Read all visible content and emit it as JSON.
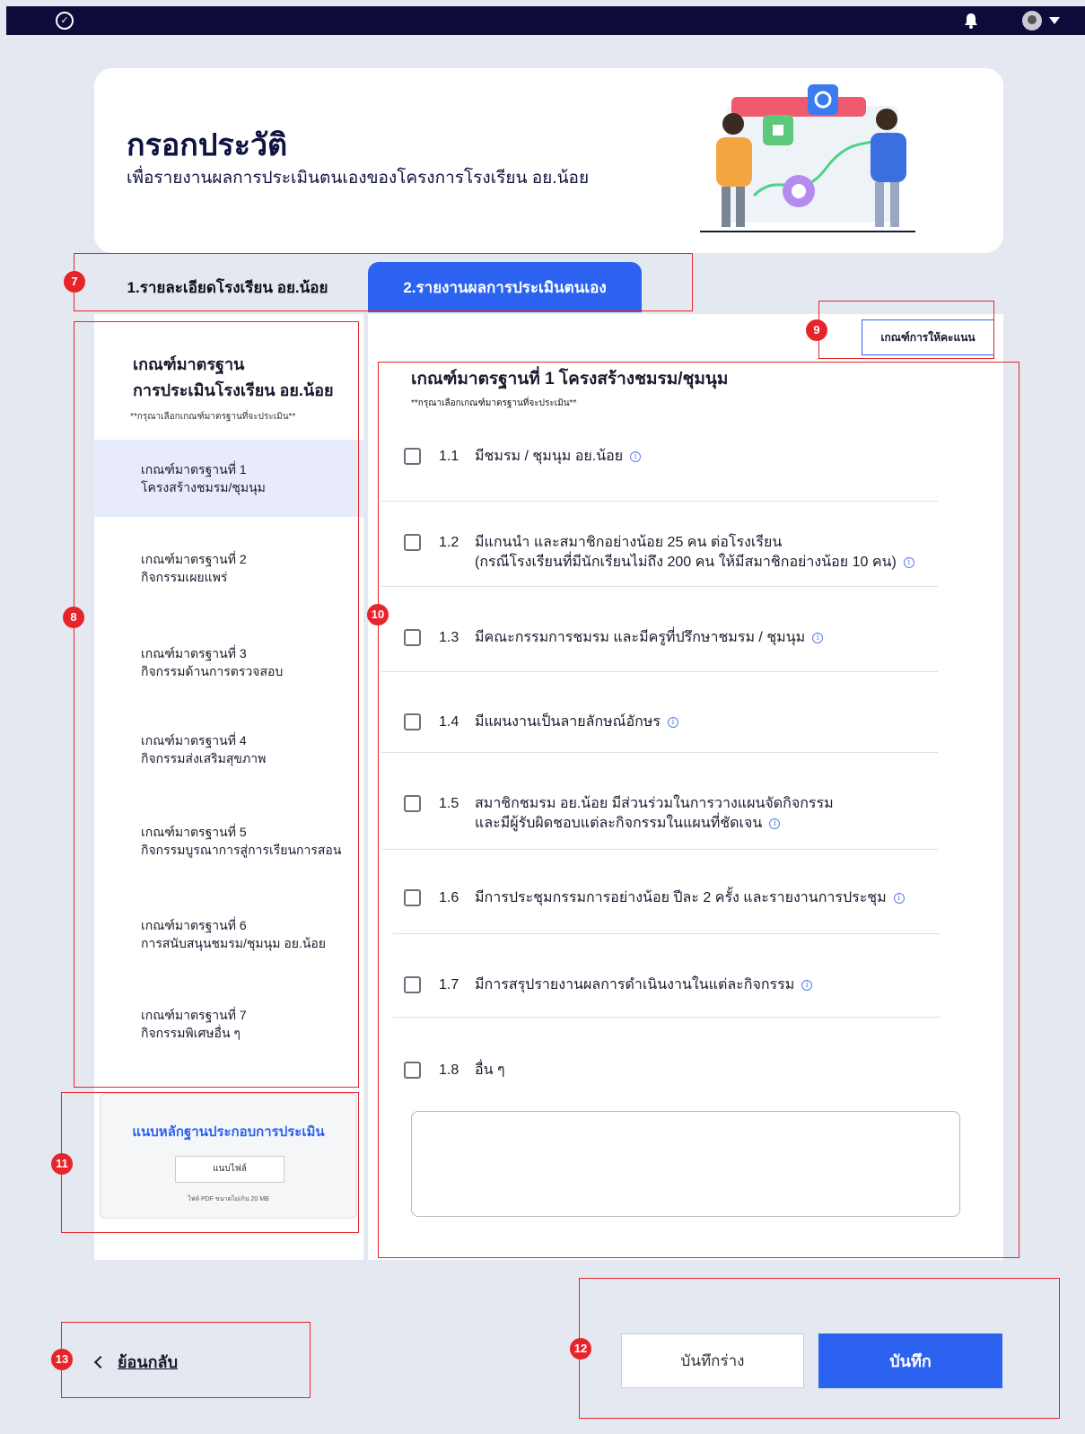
{
  "topbar": {
    "logo_icon": "brand-logo-icon",
    "bell_icon": "bell-icon",
    "avatar_icon": "avatar",
    "caret_icon": "chevron-down-icon"
  },
  "hero": {
    "title": "กรอกประวัติ",
    "subtitle": "เพื่อรายงานผลการประเมินตนเองของโครงการโรงเรียน อย.น้อย"
  },
  "tabs": [
    {
      "label": "1.รายละเอียดโรงเรียน อย.น้อย"
    },
    {
      "label": "2.รายงานผลการประเมินตนเอง"
    }
  ],
  "sidebar": {
    "title_line1": "เกณฑ์มาตรฐาน",
    "title_line2": "การประเมินโรงเรียน อย.น้อย",
    "hint": "**กรุณาเลือกเกณฑ์มาตรฐานที่จะประเมิน**",
    "items": [
      {
        "line1": "เกณฑ์มาตรฐานที่ 1",
        "line2": "โครงสร้างชมรม/ชุมนุม"
      },
      {
        "line1": "เกณฑ์มาตรฐานที่ 2",
        "line2": "กิจกรรมเผยแพร่"
      },
      {
        "line1": "เกณฑ์มาตรฐานที่ 3",
        "line2": "กิจกรรมด้านการตรวจสอบ"
      },
      {
        "line1": "เกณฑ์มาตรฐานที่ 4",
        "line2": "กิจกรรมส่งเสริมสุขภาพ"
      },
      {
        "line1": "เกณฑ์มาตรฐานที่ 5",
        "line2": "กิจกรรมบูรณาการสู่การเรียนการสอน"
      },
      {
        "line1": "เกณฑ์มาตรฐานที่ 6",
        "line2": "การสนับสนุนชมรม/ชุมนุม อย.น้อย"
      },
      {
        "line1": "เกณฑ์มาตรฐานที่ 7",
        "line2": "กิจกรรมพิเศษอื่น ๆ"
      }
    ],
    "attach": {
      "title": "แนบหลักฐานประกอบการประเมิน",
      "button": "แนบไฟล์",
      "note": "ไฟล์ PDF ขนาดไม่เกิน 20 MB"
    }
  },
  "main": {
    "criteria_button": "เกณฑ์การให้คะแนน",
    "title": "เกณฑ์มาตรฐานที่ 1 โครงสร้างชมรม/ชุมนุม",
    "hint": "**กรุณาเลือกเกณฑ์มาตรฐานที่จะประเมิน**",
    "items": [
      {
        "num": "1.1",
        "line1": "มีชมรม / ชุมนุม อย.น้อย",
        "line2": "",
        "info": "i"
      },
      {
        "num": "1.2",
        "line1": "มีแกนนำ และสมาชิกอย่างน้อย 25 คน ต่อโรงเรียน",
        "line2": "(กรณีโรงเรียนที่มีนักเรียนไม่ถึง 200 คน ให้มีสมาชิกอย่างน้อย 10 คน)",
        "info": "i"
      },
      {
        "num": "1.3",
        "line1": "มีคณะกรรมการชมรม และมีครูที่ปรึกษาชมรม / ชุมนุม",
        "line2": "",
        "info": "i"
      },
      {
        "num": "1.4",
        "line1": "มีแผนงานเป็นลายลักษณ์อักษร",
        "line2": "",
        "info": "i"
      },
      {
        "num": "1.5",
        "line1": "สมาชิกชมรม อย.น้อย มีส่วนร่วมในการวางแผนจัดกิจกรรม",
        "line2": "และมีผู้รับผิดชอบแต่ละกิจกรรมในแผนที่ชัดเจน",
        "info": "i"
      },
      {
        "num": "1.6",
        "line1": "มีการประชุมกรรมการอย่างน้อย ปีละ 2 ครั้ง และรายงานการประชุม",
        "line2": "",
        "info": "i"
      },
      {
        "num": "1.7",
        "line1": "มีการสรุปรายงานผลการดำเนินงานในแต่ละกิจกรรม",
        "line2": "",
        "info": "i"
      },
      {
        "num": "1.8",
        "line1": "อื่น ๆ",
        "line2": "",
        "info": ""
      }
    ]
  },
  "footer": {
    "back": "ย้อนกลับ",
    "draft": "บันทึกร่าง",
    "save": "บันทึก"
  },
  "annotations": [
    "7",
    "8",
    "9",
    "10",
    "11",
    "12",
    "13"
  ],
  "colors": {
    "accent": "#2b63f0",
    "navbar": "#0c0b3a",
    "annotation": "#e8242b"
  }
}
